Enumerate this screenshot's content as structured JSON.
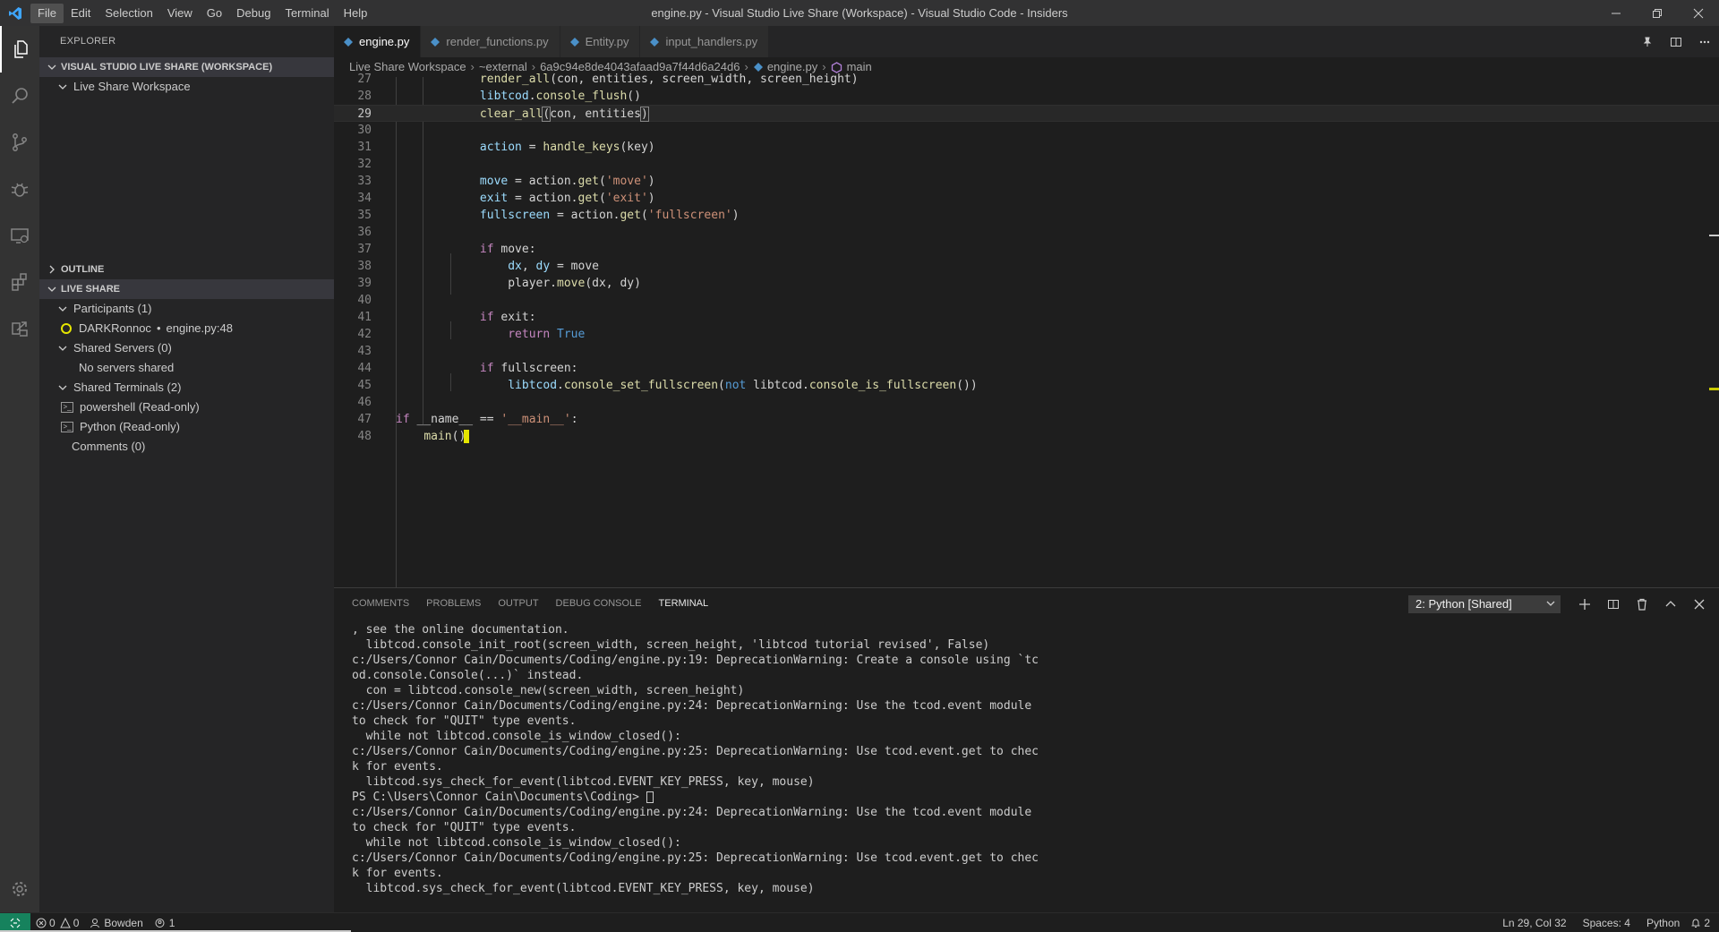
{
  "titlebar": {
    "title": "engine.py - Visual Studio Live Share (Workspace) - Visual Studio Code - Insiders",
    "menu": [
      "File",
      "Edit",
      "Selection",
      "View",
      "Go",
      "Debug",
      "Terminal",
      "Help"
    ]
  },
  "activitybar": {
    "items": [
      "explorer-icon",
      "search-icon",
      "source-control-icon",
      "debug-icon",
      "remote-explorer-icon",
      "extensions-icon",
      "live-share-icon"
    ],
    "bottom": "settings-gear-icon"
  },
  "sidebar": {
    "title": "EXPLORER",
    "workspace_header": "VISUAL STUDIO LIVE SHARE (WORKSPACE)",
    "workspace_item": "Live Share Workspace",
    "outline_header": "OUTLINE",
    "liveshare_header": "LIVE SHARE",
    "participants_label": "Participants (1)",
    "participant_name": "DARKRonnoc",
    "participant_location": "engine.py:48",
    "servers_label": "Shared Servers (0)",
    "no_servers": "No servers shared",
    "terminals_label": "Shared Terminals (2)",
    "terminal_1": "powershell (Read-only)",
    "terminal_2": "Python (Read-only)",
    "comments_label": "Comments (0)"
  },
  "editor": {
    "tabs": [
      "engine.py",
      "render_functions.py",
      "Entity.py",
      "input_handlers.py"
    ],
    "breadcrumb": [
      "Live Share Workspace",
      "~external",
      "6a9c94e8de4043afaad9a7f44d6a24d6",
      "engine.py",
      "main"
    ],
    "line_numbers": [
      "27",
      "28",
      "29",
      "30",
      "31",
      "32",
      "33",
      "34",
      "35",
      "36",
      "37",
      "38",
      "39",
      "40",
      "41",
      "42",
      "43",
      "44",
      "45",
      "46",
      "47",
      "48"
    ],
    "current_line": "29"
  },
  "panel": {
    "tabs": [
      "COMMENTS",
      "PROBLEMS",
      "OUTPUT",
      "DEBUG CONSOLE",
      "TERMINAL"
    ],
    "active_tab": "TERMINAL",
    "terminal_select": "2: Python [Shared]",
    "terminal_lines": [
      ", see the online documentation.",
      "  libtcod.console_init_root(screen_width, screen_height, 'libtcod tutorial revised', False)",
      "c:/Users/Connor Cain/Documents/Coding/engine.py:19: DeprecationWarning: Create a console using `tc",
      "od.console.Console(...)` instead.",
      "  con = libtcod.console_new(screen_width, screen_height)",
      "c:/Users/Connor Cain/Documents/Coding/engine.py:24: DeprecationWarning: Use the tcod.event module",
      "to check for \"QUIT\" type events.",
      "  while not libtcod.console_is_window_closed():",
      "c:/Users/Connor Cain/Documents/Coding/engine.py:25: DeprecationWarning: Use tcod.event.get to chec",
      "k for events.",
      "  libtcod.sys_check_for_event(libtcod.EVENT_KEY_PRESS, key, mouse)",
      "PS C:\\Users\\Connor Cain\\Documents\\Coding> ",
      "c:/Users/Connor Cain/Documents/Coding/engine.py:24: DeprecationWarning: Use the tcod.event module",
      "to check for \"QUIT\" type events.",
      "  while not libtcod.console_is_window_closed():",
      "c:/Users/Connor Cain/Documents/Coding/engine.py:25: DeprecationWarning: Use tcod.event.get to chec",
      "k for events.",
      "  libtcod.sys_check_for_event(libtcod.EVENT_KEY_PRESS, key, mouse)"
    ]
  },
  "statusbar": {
    "errors": "0",
    "warnings": "0",
    "user": "Bowden",
    "shared_count": "1",
    "position": "Ln 29, Col 32",
    "spaces": "Spaces: 4",
    "language": "Python",
    "notifications": "2"
  },
  "colors": {
    "accent": "#16825d",
    "participant_ring": "#e5e500"
  }
}
